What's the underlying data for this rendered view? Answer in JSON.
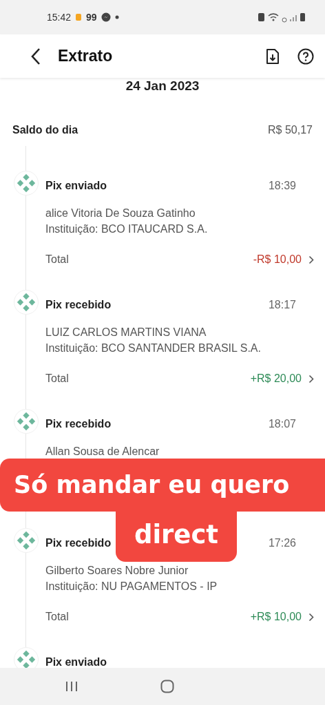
{
  "status_bar": {
    "time": "15:42",
    "notification_count": "99"
  },
  "header": {
    "title": "Extrato"
  },
  "date": "24 Jan 2023",
  "balance": {
    "label": "Saldo do dia",
    "value": "R$ 50,17"
  },
  "transactions": [
    {
      "kind": "sent",
      "title": "Pix enviado",
      "time": "18:39",
      "name": "alice Vitoria De Souza Gatinho",
      "institution": "Instituição: BCO ITAUCARD S.A.",
      "total_label": "Total",
      "amount": "-R$ 10,00"
    },
    {
      "kind": "received",
      "title": "Pix recebido",
      "time": "18:17",
      "name": "LUIZ CARLOS MARTINS VIANA",
      "institution": "Instituição: BCO SANTANDER  BRASIL  S.A.",
      "total_label": "Total",
      "amount": "+R$ 20,00"
    },
    {
      "title": "Pix recebido",
      "time": "18:07",
      "name": "Allan Sousa de Alencar"
    },
    {
      "kind": "received",
      "title": "Pix recebido",
      "time": "17:26",
      "name": "Gilberto Soares Nobre Junior",
      "institution": "Instituição: NU PAGAMENTOS - IP",
      "total_label": "Total",
      "amount": "+R$ 10,00"
    },
    {
      "title": "Pix enviado"
    }
  ],
  "caption": {
    "lines": [
      "Só mandar eu quero",
      "direct"
    ]
  }
}
